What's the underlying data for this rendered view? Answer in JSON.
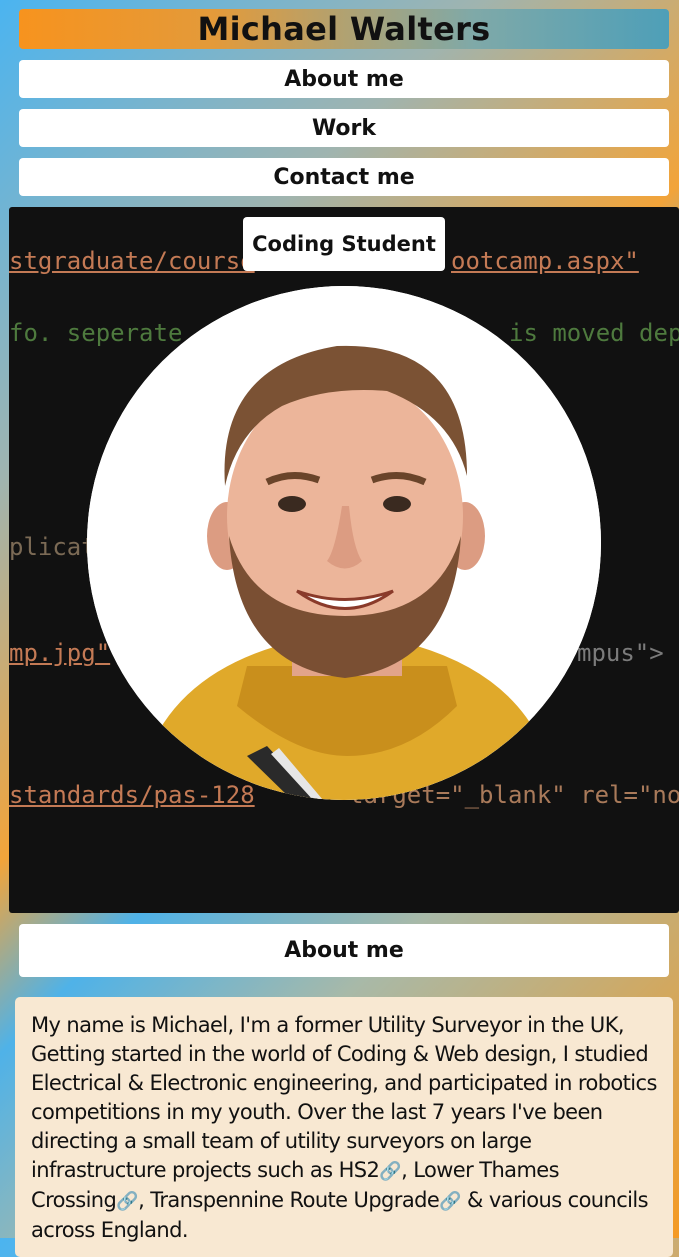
{
  "header": {
    "title": "Michael Walters"
  },
  "nav": {
    "items": [
      {
        "label": "About me"
      },
      {
        "label": "Work"
      },
      {
        "label": "Contact me"
      }
    ]
  },
  "hero": {
    "badge": "Coding Student",
    "code_lines": [
      "stgraduate/course",
      "ootcamp.aspx\"",
      "fo. seperate",
      "is moved dep",
      "plicat",
      "mp.jpg\"",
      "mpus\">",
      "standards/pas-128",
      "target=\"_blank\" rel=\"no"
    ],
    "photo_alt": "profile photo"
  },
  "about": {
    "heading": "About me",
    "text_part1": "My name is Michael, I'm a former Utility Surveyor in the UK, Getting started in the world of Coding & Web design, I studied Electrical & Electronic engineering, and participated in robotics competitions in my youth. Over the last 7 years I've been directing a small team of utility surveyors on large infrastructure projects such as ",
    "link1": "HS2",
    "sep1": ", ",
    "link2": "Lower Thames Crossing",
    "sep2": ", ",
    "link3": "Transpennine Route Upgrade",
    "text_part2": " & various councils across England."
  },
  "colors": {
    "orange": "#f7931e",
    "blue": "#4bb4f0",
    "about_bg": "#f8e8d2",
    "hero_bg": "#111111"
  }
}
